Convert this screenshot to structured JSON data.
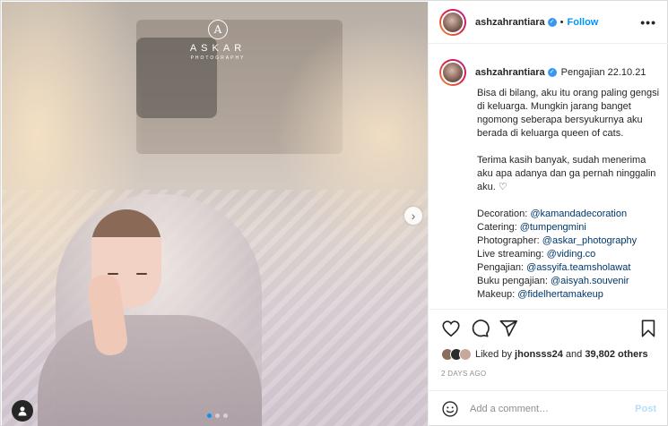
{
  "post": {
    "username": "ashzahrantiara",
    "follow_label": "Follow",
    "separator": "•",
    "more_label": "•••",
    "location": "Pengajian 22.10.21"
  },
  "photo": {
    "watermark_logo": "A",
    "watermark_title": "ASKAR",
    "watermark_subtitle": "PHOTOGRAPHY",
    "next_glyph": "›",
    "carousel_count": 3,
    "carousel_active": 0
  },
  "caption": {
    "paragraph1": "Bisa di bilang, aku itu orang paling gengsi di keluarga. Mungkin jarang banget ngomong seberapa bersyukurnya aku berada di keluarga queen of cats.",
    "paragraph2": "Terima kasih banyak, sudah menerima aku apa adanya dan ga pernah ninggalin aku. ♡",
    "credits": [
      {
        "label": "Decoration:",
        "handle": "@kamandadecoration"
      },
      {
        "label": "Catering:",
        "handle": "@tumpengmini"
      },
      {
        "label": "Photographer:",
        "handle": "@askar_photography"
      },
      {
        "label": "Live streaming:",
        "handle": "@viding.co"
      },
      {
        "label": "Pengajian:",
        "handle": "@assyifa.teamsholawat"
      },
      {
        "label": "Buku pengajian:",
        "handle": "@aisyah.souvenir"
      },
      {
        "label": "Makeup:",
        "handle": "@fidelhertamakeup"
      }
    ]
  },
  "likes": {
    "prefix": "Liked by",
    "first_user": "jhonsss24",
    "and": "and",
    "others": "39,802 others"
  },
  "time_ago": "2 DAYS AGO",
  "comment": {
    "placeholder": "Add a comment…",
    "post_label": "Post"
  },
  "colors": {
    "accent": "#0095f6",
    "mention": "#00376b",
    "verified": "#3897f0"
  }
}
